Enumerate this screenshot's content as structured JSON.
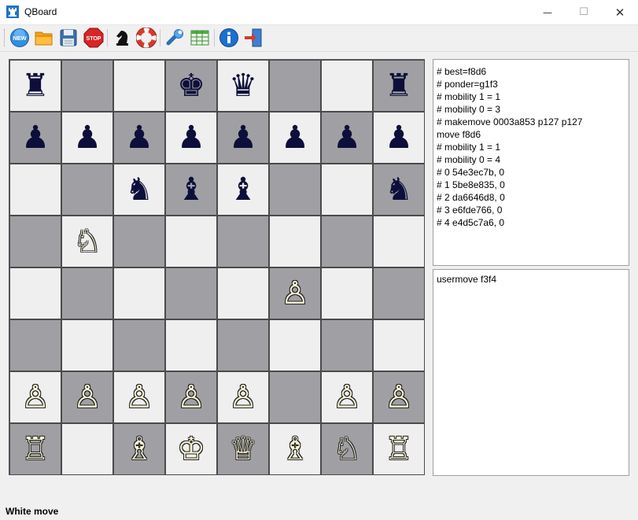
{
  "window": {
    "title": "QBoard",
    "minimize_glyph": "—",
    "maximize_glyph": "☐",
    "close_glyph": "✕"
  },
  "toolbar": {
    "new_label": "NEW",
    "stop_label": "STOP",
    "buttons": [
      "new-icon",
      "open-folder-icon",
      "save-icon",
      "stop-icon",
      "chess-knight-icon",
      "lifebuoy-icon",
      "wrench-icon",
      "table-icon",
      "info-icon",
      "exit-icon"
    ]
  },
  "board": {
    "ranks": [
      [
        "♜",
        "",
        "",
        "♚",
        "♛",
        "",
        "",
        "♜"
      ],
      [
        "♟",
        "♟",
        "♟",
        "♟",
        "♟",
        "♟",
        "♟",
        "♟"
      ],
      [
        "",
        "",
        "♞",
        "♝",
        "♝",
        "",
        "",
        "♞"
      ],
      [
        "",
        "♘",
        "",
        "",
        "",
        "",
        "",
        ""
      ],
      [
        "",
        "",
        "",
        "",
        "",
        "♙",
        "",
        ""
      ],
      [
        "",
        "",
        "",
        "",
        "",
        "",
        "",
        ""
      ],
      [
        "♙",
        "♙",
        "♙",
        "♙",
        "♙",
        "",
        "♙",
        "♙"
      ],
      [
        "♖",
        "",
        "♗",
        "♔",
        "♕",
        "♗",
        "♘",
        "♖"
      ]
    ]
  },
  "engine_log": [
    "# best=f8d6",
    "# ponder=g1f3",
    "# mobility 1 = 1",
    "# mobility 0 = 3",
    "# makemove 0003a853 p127 p127",
    "move f8d6",
    "# mobility 1 = 1",
    "# mobility 0 = 4",
    "# 0 54e3ec7b, 0",
    "# 1 5be8e835, 0",
    "# 2 da6646d8, 0",
    "# 3 e6fde766, 0",
    "# 4 e4d5c7a6, 0"
  ],
  "command_panel": {
    "text": "usermove f3f4"
  },
  "status": {
    "text": "White move"
  },
  "colors": {
    "light_square": "#efefef",
    "dark_square": "#a0a0a4",
    "black_piece": "#0d0f3a",
    "white_piece": "#fbf6d4"
  }
}
